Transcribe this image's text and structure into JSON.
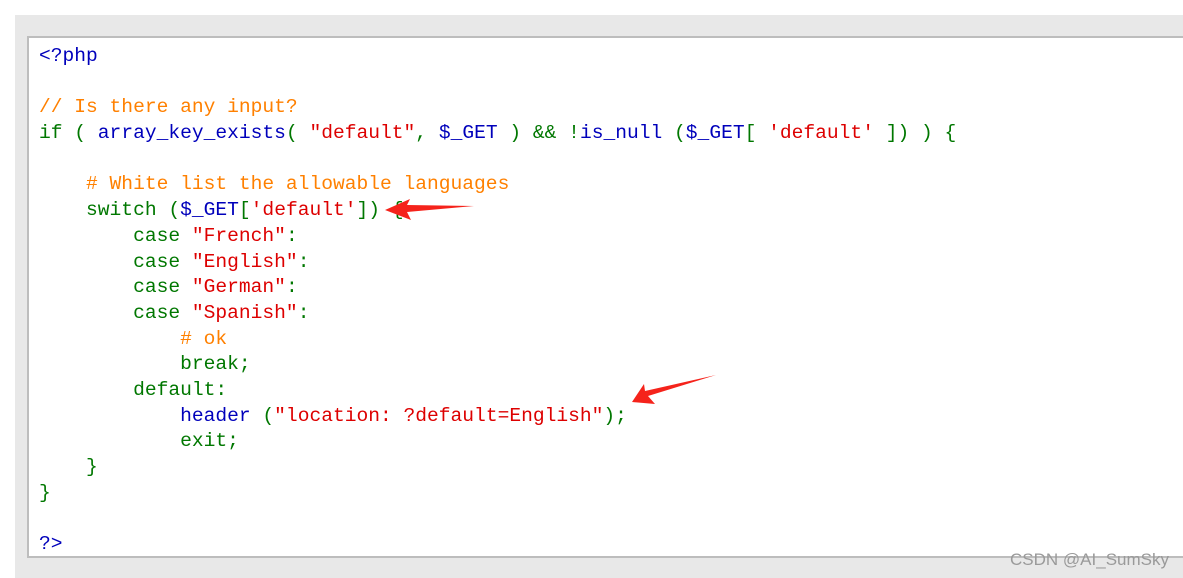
{
  "colors": {
    "html": "#0000BB",
    "default": "#0000BB",
    "keyword": "#007700",
    "string": "#DD0000",
    "comment": "#FF8000",
    "arrow": "#F5231B"
  },
  "code_lines": [
    [
      [
        "html",
        "<?php"
      ]
    ],
    [],
    [
      [
        "comment",
        "// Is there any input?"
      ]
    ],
    [
      [
        "keyword",
        "if ( "
      ],
      [
        "default",
        "array_key_exists"
      ],
      [
        "keyword",
        "( "
      ],
      [
        "string",
        "\"default\""
      ],
      [
        "keyword",
        ", "
      ],
      [
        "default",
        "$_GET "
      ],
      [
        "keyword",
        ") && !"
      ],
      [
        "default",
        "is_null "
      ],
      [
        "keyword",
        "("
      ],
      [
        "default",
        "$_GET"
      ],
      [
        "keyword",
        "[ "
      ],
      [
        "string",
        "'default' "
      ],
      [
        "keyword",
        "]) ) {"
      ]
    ],
    [],
    [
      [
        "comment",
        "    # White list the allowable languages"
      ]
    ],
    [
      [
        "keyword",
        "    switch ("
      ],
      [
        "default",
        "$_GET"
      ],
      [
        "keyword",
        "["
      ],
      [
        "string",
        "'default'"
      ],
      [
        "keyword",
        "]) {"
      ]
    ],
    [
      [
        "keyword",
        "        case "
      ],
      [
        "string",
        "\"French\""
      ],
      [
        "keyword",
        ":"
      ]
    ],
    [
      [
        "keyword",
        "        case "
      ],
      [
        "string",
        "\"English\""
      ],
      [
        "keyword",
        ":"
      ]
    ],
    [
      [
        "keyword",
        "        case "
      ],
      [
        "string",
        "\"German\""
      ],
      [
        "keyword",
        ":"
      ]
    ],
    [
      [
        "keyword",
        "        case "
      ],
      [
        "string",
        "\"Spanish\""
      ],
      [
        "keyword",
        ":"
      ]
    ],
    [
      [
        "comment",
        "            # ok"
      ]
    ],
    [
      [
        "keyword",
        "            break;"
      ]
    ],
    [
      [
        "keyword",
        "        default:"
      ]
    ],
    [
      [
        "default",
        "            header "
      ],
      [
        "keyword",
        "("
      ],
      [
        "string",
        "\"location: ?default=English\""
      ],
      [
        "keyword",
        ");"
      ]
    ],
    [
      [
        "keyword",
        "            exit;"
      ]
    ],
    [
      [
        "keyword",
        "    }"
      ]
    ],
    [
      [
        "keyword",
        "}"
      ]
    ],
    [],
    [
      [
        "html",
        "?>"
      ]
    ]
  ],
  "watermark": "CSDN @AI_SumSky"
}
